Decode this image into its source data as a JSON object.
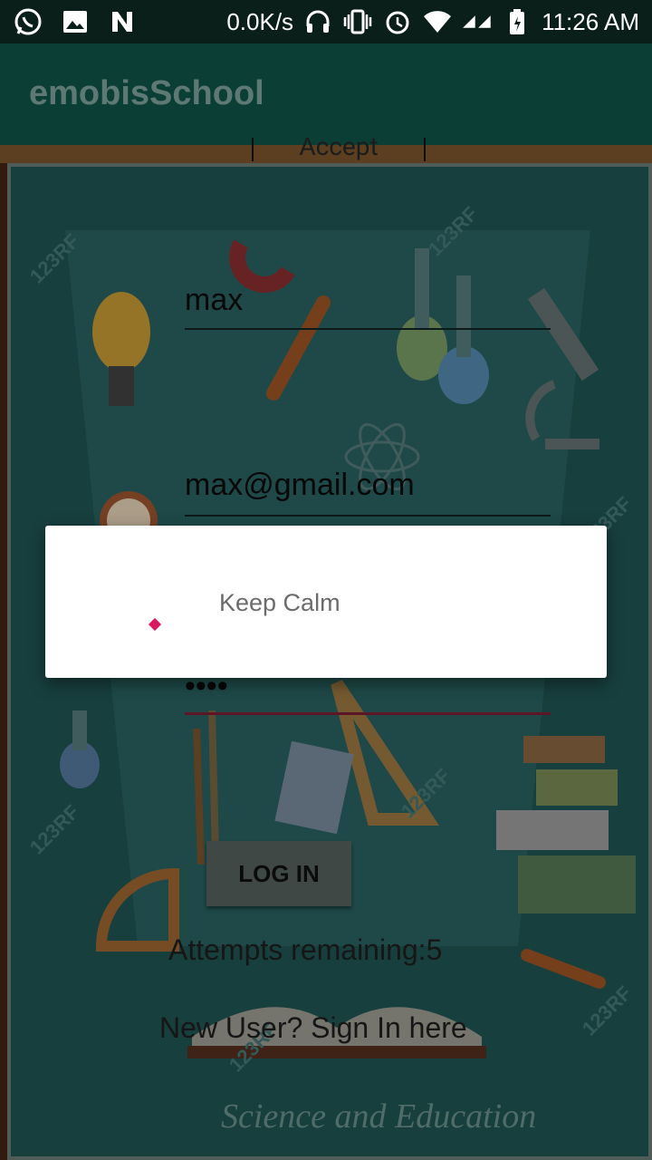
{
  "status_bar": {
    "net_speed": "0.0K/s",
    "time": "11:26 AM",
    "icons": [
      "whatsapp-icon",
      "image-icon",
      "n-icon",
      "headphones-icon",
      "vibrate-icon",
      "alarm-icon",
      "wifi-icon",
      "signal-icon",
      "battery-icon"
    ]
  },
  "app": {
    "title": "emobisSchool"
  },
  "background": {
    "accept_label": "Accept",
    "watermark": "123RF",
    "caption": "Science and Education"
  },
  "form": {
    "name_value": "max",
    "email_value": "max@gmail.com",
    "password_value": "••••",
    "login_label": "LOG IN",
    "attempts_text": "Attempts remaining:5",
    "signup_text": "New User? Sign In here"
  },
  "dialog": {
    "message": "Keep Calm",
    "accent": "#d81b60"
  }
}
